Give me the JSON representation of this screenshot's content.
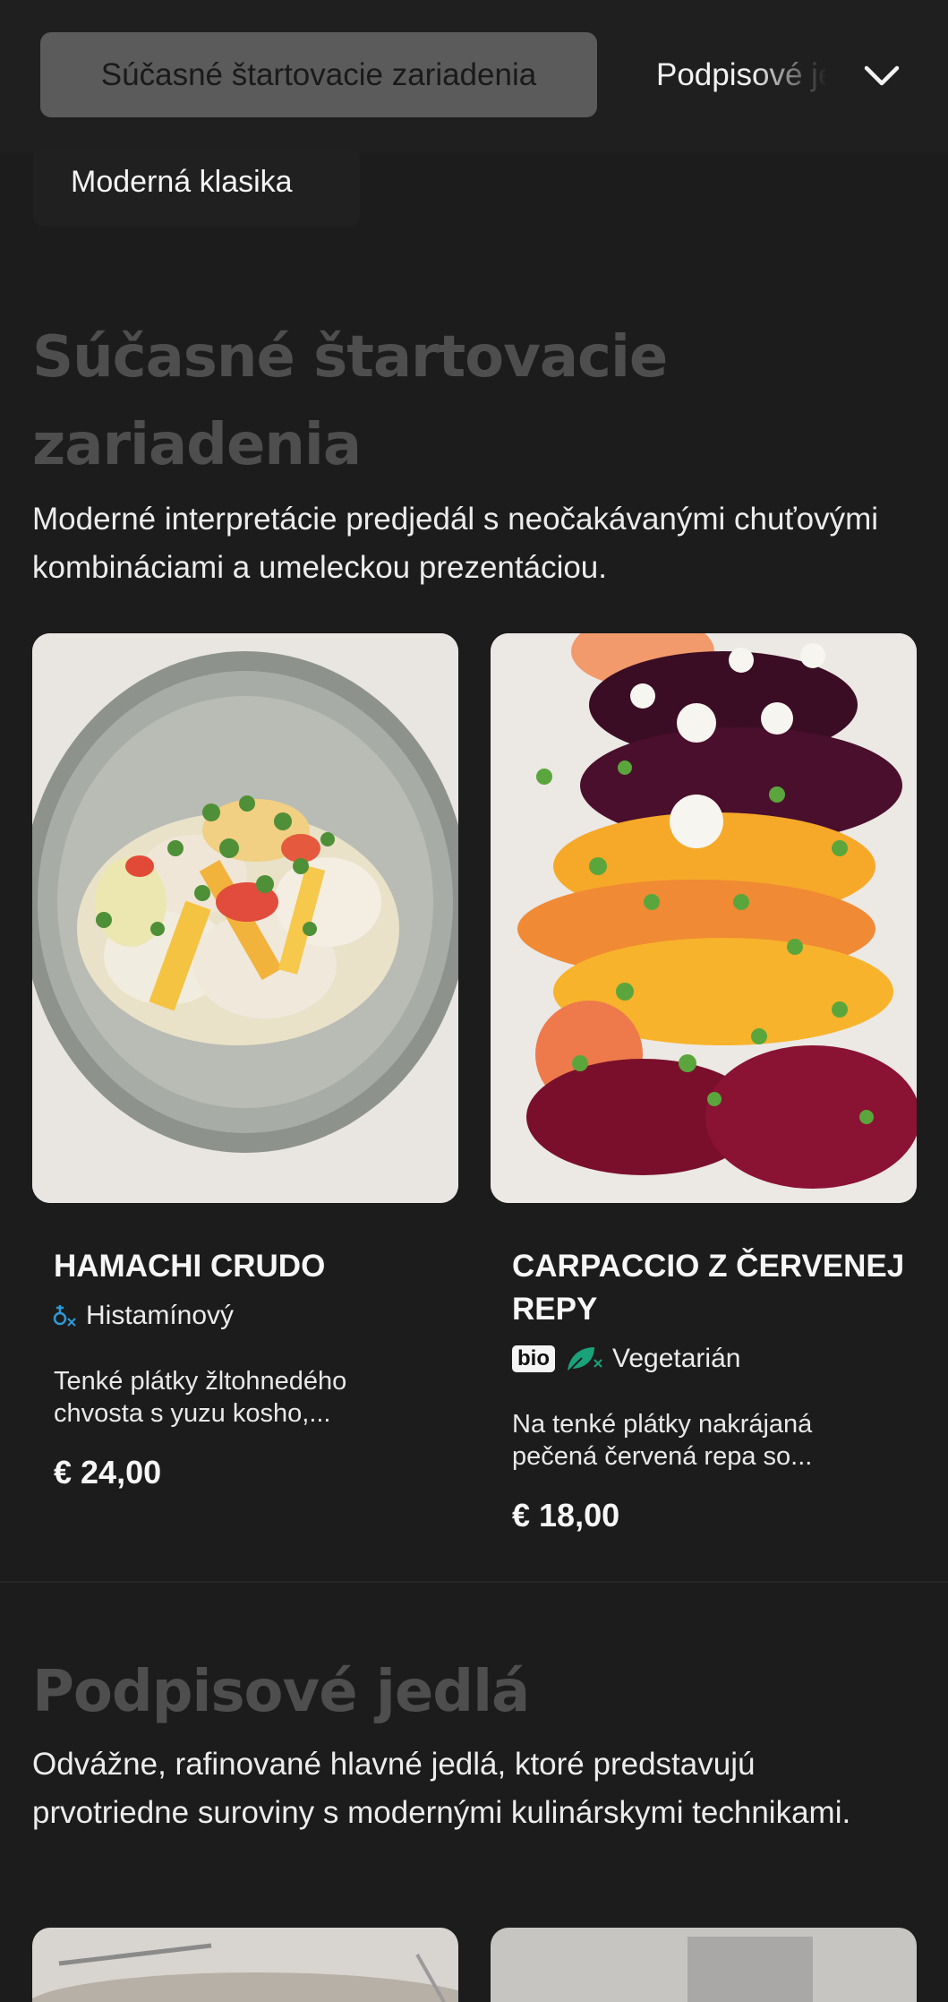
{
  "nav": {
    "active_tab": "Súčasné štartovacie zariadenia",
    "next_tab": "Podpisové jedlá",
    "sub_tab": "Moderná klasika"
  },
  "sections": [
    {
      "title": "Súčasné štartovacie zariadenia",
      "description": "Moderné interpretácie predjedál s neočakávanými chuťovými kombináciami a umeleckou prezentáciou.",
      "items": [
        {
          "name": "HAMACHI CRUDO",
          "tags": [
            "Histamínový"
          ],
          "description": "Tenké plátky žltohnedého chvosta s yuzu kosho,...",
          "price": "€ 24,00"
        },
        {
          "name": "CARPACCIO Z ČERVENEJ REPY",
          "badge": "bio",
          "tags": [
            "Vegetarián"
          ],
          "description": "Na tenké plátky nakrájaná pečená červená repa so...",
          "price": "€ 18,00"
        }
      ]
    },
    {
      "title": "Podpisové jedlá",
      "description": "Odvážne, rafinované hlavné jedlá, ktoré predstavujú prvotriedne suroviny s modernými kulinárskymi technikami."
    }
  ],
  "colors": {
    "background": "#1c1c1d",
    "title_gray": "#4e4e4f",
    "histamine_icon": "#2f9ad6",
    "vegetarian_icon": "#1aa37a"
  }
}
